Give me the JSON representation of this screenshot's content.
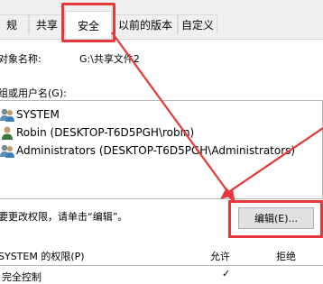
{
  "tabs": [
    {
      "label": "规",
      "active": false
    },
    {
      "label": "共享",
      "active": false
    },
    {
      "label": "安全",
      "active": true
    },
    {
      "label": "以前的版本",
      "active": false
    },
    {
      "label": "自定义",
      "active": false
    }
  ],
  "object_name": {
    "label": "对象名称:",
    "value": "G:\\共享文件2"
  },
  "group_label": "组或用户名(G):",
  "users": [
    {
      "name": "SYSTEM",
      "icon": "group-users-icon"
    },
    {
      "name": "Robin (DESKTOP-T6D5PGH\\robin)",
      "icon": "user-icon"
    },
    {
      "name": "Administrators (DESKTOP-T6D5PGH\\Administrators)",
      "icon": "group-users-icon"
    }
  ],
  "change_perm_text": "要更改权限，请单击“编辑”。",
  "edit_button": "编辑(E)...",
  "permissions": {
    "header": "SYSTEM 的权限(P)",
    "allow": "允许",
    "deny": "拒绝",
    "first_row_fragment": "完全控制"
  },
  "colors": {
    "highlight": "#e5383b",
    "tab_bg": "#f0f0f0",
    "button_bg": "#e1e1e1"
  }
}
